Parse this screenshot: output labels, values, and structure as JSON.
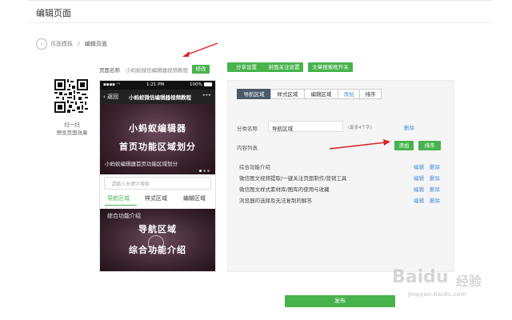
{
  "page": {
    "title": "编辑页面",
    "breadcrumb": {
      "parent": "页面模板",
      "separator": "/",
      "current": "编辑页面"
    },
    "back_glyph": "‹"
  },
  "qr": {
    "line1": "扫一扫",
    "line2": "预览页面效果"
  },
  "page_name": {
    "label": "页面名称",
    "value": "小蚂蚁微信编辑器视频教程",
    "edit_button": "修改"
  },
  "top_actions": {
    "share": "分享设置",
    "cover": "封面关注设置",
    "search_switch": "文章搜索框开关"
  },
  "phone": {
    "status_time": "1:21 PM",
    "status_battery": "100%",
    "back_label": "‹ 返回",
    "nav_title": "小蚂蚁微信编辑器视频教程",
    "menu_glyph": "•••",
    "banner_title1": "小蚂蚁编辑器",
    "banner_title2": "首页功能区域划分",
    "banner_caption": "小蚂蚁编辑器首页功能区域划分",
    "search_placeholder": "请输入关键字搜索",
    "tabs": [
      "导航区域",
      "样式区域",
      "编辑区域"
    ],
    "card_caption": "综合功能介绍",
    "card_title1": "导航区域",
    "card_title2": "综合功能介绍"
  },
  "panel": {
    "tabs": [
      "导航区域",
      "样式区域",
      "编辑区域",
      "添加",
      "排序"
    ],
    "category_label": "分类名称",
    "category_value": "导航区域",
    "category_hint": "(最多4个字)",
    "category_delete": "删除",
    "content_label": "内容列表",
    "add_button": "添加",
    "sort_button": "排序",
    "rows": [
      "综合功能介绍",
      "微信图文视频提取/一键关注页面制作/营销工具",
      "微信图文样式素材库/图库的使用与收藏",
      "浏览器的选择及无法复制的解答"
    ],
    "edit_label": "编辑",
    "delete_label": "删除"
  },
  "publish_button": "发布",
  "watermark": {
    "brand": "Baidu",
    "cn": "经验",
    "sub": "jingyan.baidu.com"
  },
  "colors": {
    "primary_green": "#47b34d",
    "link_blue": "#4a90d9",
    "annotation_red": "#dd2222",
    "active_tab": "#4a5a6a"
  }
}
